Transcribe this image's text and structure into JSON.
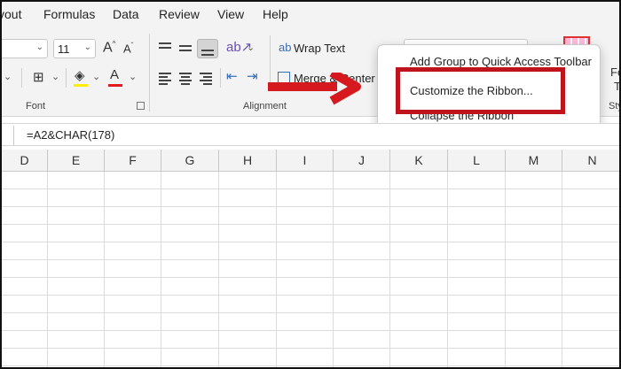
{
  "menu_tabs": [
    "yout",
    "Formulas",
    "Data",
    "Review",
    "View",
    "Help"
  ],
  "ribbon": {
    "font_size": "11",
    "wrap_text_label": "Wrap Text",
    "merge_center_label": "Merge & Center",
    "groups": {
      "font": "Font",
      "alignment": "Alignment",
      "styles_partial": "Sty"
    },
    "partial_right_top": "Fo",
    "partial_right_mid": "T"
  },
  "context_menu": {
    "items": [
      {
        "label": "Add Group to Quick Access Toolbar"
      },
      {
        "label": "Customize the Ribbon..."
      },
      {
        "label": "Collapse the Ribbon"
      }
    ],
    "highlighted_item": "Customize the Ribbon..."
  },
  "formula_bar": {
    "formula": "=A2&CHAR(178)"
  },
  "columns": [
    "D",
    "E",
    "F",
    "G",
    "H",
    "I",
    "J",
    "K",
    "L",
    "M",
    "N"
  ],
  "colors": {
    "highlight": "#c0141c",
    "arrow": "#d6191f",
    "ribbon_bg": "#f3f3f3"
  },
  "icons": [
    "increase-font-icon",
    "decrease-font-icon",
    "borders-icon",
    "fill-color-icon",
    "font-color-icon",
    "align-top-icon",
    "align-middle-icon",
    "align-bottom-icon",
    "orientation-icon",
    "align-left-icon",
    "align-center-icon",
    "align-right-icon",
    "decrease-indent-icon",
    "increase-indent-icon",
    "wrap-text-icon",
    "merge-center-icon",
    "dialog-launcher-icon",
    "red-arrow-icon"
  ]
}
